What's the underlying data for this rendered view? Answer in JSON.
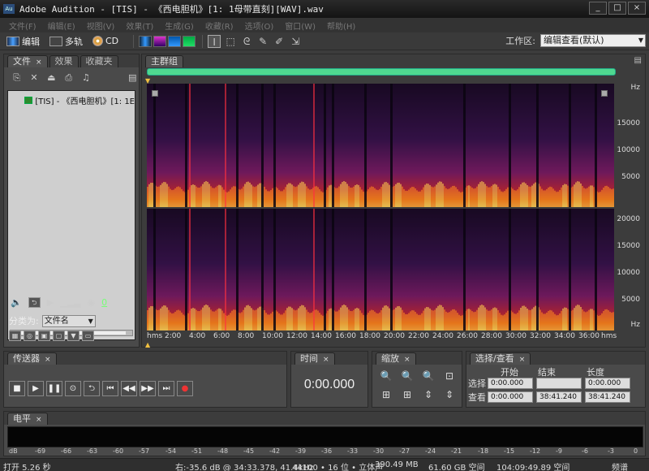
{
  "window": {
    "title": "Adobe Audition - [TIS] - 《西电胆机》[1: 1母带直刻][WAV].wav",
    "app_icon": "Au",
    "controls": [
      "_",
      "□",
      "×"
    ]
  },
  "menu": [
    "文件(F)",
    "编辑(E)",
    "视图(V)",
    "效果(T)",
    "生成(G)",
    "收藏(R)",
    "选项(O)",
    "窗口(W)",
    "帮助(H)"
  ],
  "toolbar": {
    "edit_label": "编辑",
    "multitrack_label": "多轨",
    "cd_label": "CD",
    "workspace_label": "工作区:",
    "workspace_value": "编辑查看(默认)"
  },
  "files_panel": {
    "tabs": [
      "文件",
      "效果",
      "收藏夹"
    ],
    "file_item": "[TIS] - 《西电胆机》[1: 1E",
    "sort_label": "分类为:",
    "sort_value": "文件名",
    "level_value": "0"
  },
  "main_panel": {
    "tab": "主群组",
    "hz_label": "Hz",
    "top_ticks": [
      "15000",
      "10000",
      "5000"
    ],
    "bottom_ticks": [
      "20000",
      "15000",
      "10000",
      "5000"
    ],
    "x_ticks": [
      "hms",
      "2:00",
      "4:00",
      "6:00",
      "8:00",
      "10:00",
      "12:00",
      "14:00",
      "16:00",
      "18:00",
      "20:00",
      "22:00",
      "24:00",
      "26:00",
      "28:00",
      "30:00",
      "32:00",
      "34:00",
      "36:00",
      "hms"
    ]
  },
  "transport": {
    "tab": "传送器",
    "buttons": [
      "■",
      "▶",
      "❚❚",
      "⊙",
      "⮌",
      "⏮",
      "◀◀",
      "▶▶",
      "⏭",
      "●"
    ]
  },
  "time_panel": {
    "tab": "时间",
    "value": "0:00.000"
  },
  "zoom_panel": {
    "tab": "缩放"
  },
  "selection_panel": {
    "tab": "选择/查看",
    "headers": {
      "start": "开始",
      "end": "结束",
      "length": "长度"
    },
    "selection": {
      "label": "选择",
      "start": "0:00.000",
      "end": "",
      "length": "0:00.000"
    },
    "view": {
      "label": "查看",
      "start": "0:00.000",
      "end": "38:41.240",
      "length": "38:41.240"
    }
  },
  "level_panel": {
    "tab": "电平",
    "ticks": [
      "dB",
      "-69",
      "-66",
      "-63",
      "-60",
      "-57",
      "-54",
      "-51",
      "-48",
      "-45",
      "-42",
      "-39",
      "-36",
      "-33",
      "-30",
      "-27",
      "-24",
      "-21",
      "-18",
      "-15",
      "-12",
      "-9",
      "-6",
      "-3",
      "0"
    ]
  },
  "status": {
    "open_time": "打开 5.26 秒",
    "cursor": "右:-35.6 dB @ 34:33.378, 41.4kHz",
    "format": "44100 • 16 位 • 立体声",
    "size": "390.49 MB",
    "free_space": "61.60 GB 空间",
    "free_time": "104:09:49.89 空间",
    "view_mode": "频谱"
  }
}
